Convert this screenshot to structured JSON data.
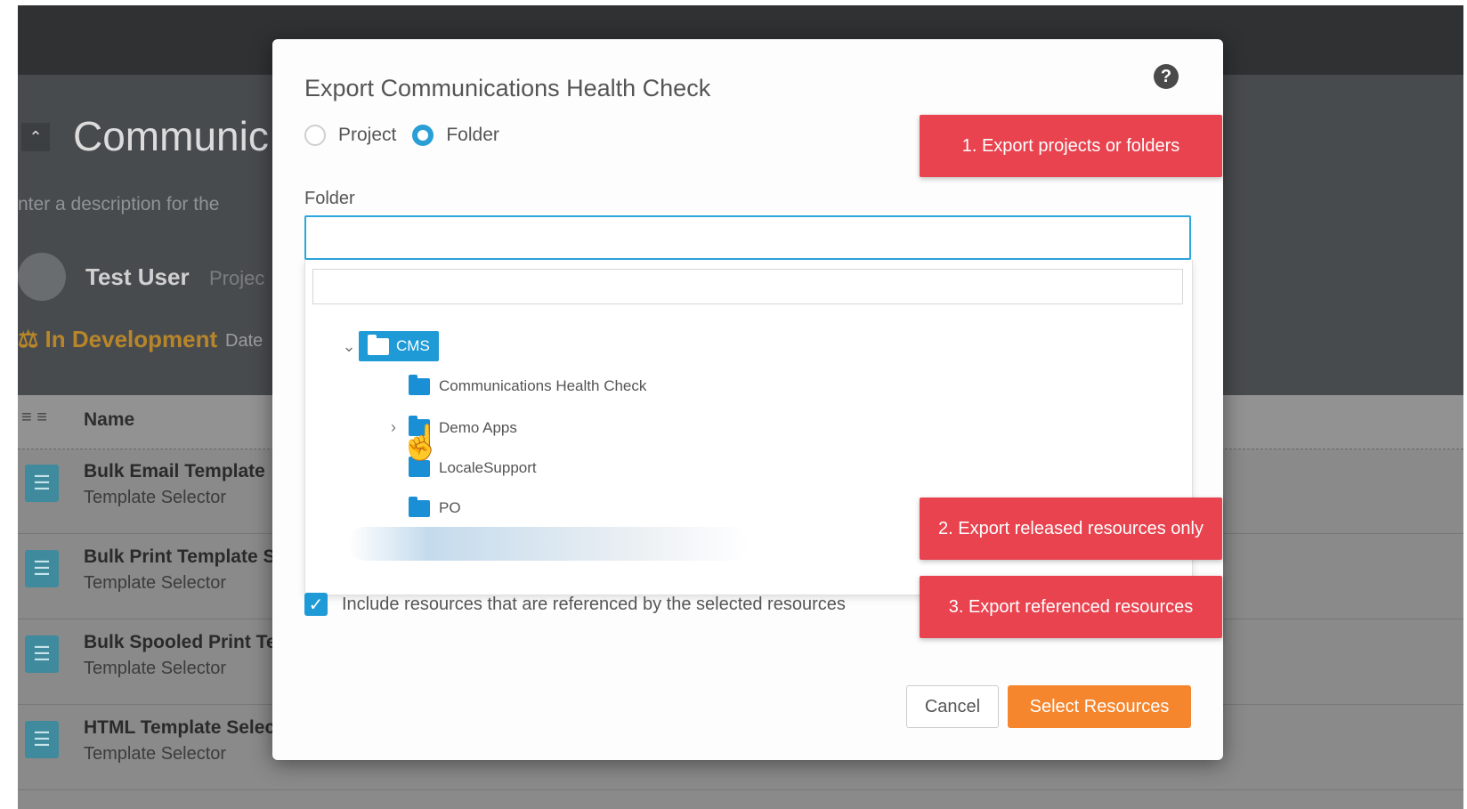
{
  "background": {
    "project_title": "Communic",
    "description_placeholder": "nter a description for the",
    "user_name": "Test User",
    "user_role": "Projec",
    "status": "In Development",
    "status_date": "Date",
    "table_header": {
      "name": "Name"
    },
    "rows": [
      {
        "title": "Bulk Email Template",
        "subtitle": "Template Selector"
      },
      {
        "title": "Bulk Print Template S",
        "subtitle": "Template Selector"
      },
      {
        "title": "Bulk Spooled Print Te",
        "subtitle": "Template Selector"
      },
      {
        "title": "HTML Template Selec",
        "subtitle": "Template Selector"
      }
    ]
  },
  "modal": {
    "title": "Export Communications Health Check",
    "help_icon": "question-circle-icon",
    "export_type": {
      "options": [
        {
          "label": "Project",
          "checked": false
        },
        {
          "label": "Folder",
          "checked": true
        }
      ]
    },
    "folder_field": {
      "label": "Folder",
      "value": "",
      "search_value": ""
    },
    "tree": {
      "root": {
        "label": "CMS",
        "expanded": true,
        "selected": true
      },
      "children": [
        {
          "label": "Communications Health Check"
        },
        {
          "label": "Demo Apps",
          "has_children": true
        },
        {
          "label": "LocaleSupport"
        },
        {
          "label": "PO"
        }
      ]
    },
    "include_referenced": {
      "checked": true,
      "label": "Include resources that are referenced by the selected resources"
    },
    "buttons": {
      "cancel": "Cancel",
      "primary": "Select Resources"
    }
  },
  "callouts": [
    "1. Export projects or folders",
    "2. Export released resources only",
    "3. Export referenced resources"
  ],
  "colors": {
    "accent_blue": "#1e9ad6",
    "primary_orange": "#f5862d",
    "callout_red": "#e8434f"
  }
}
